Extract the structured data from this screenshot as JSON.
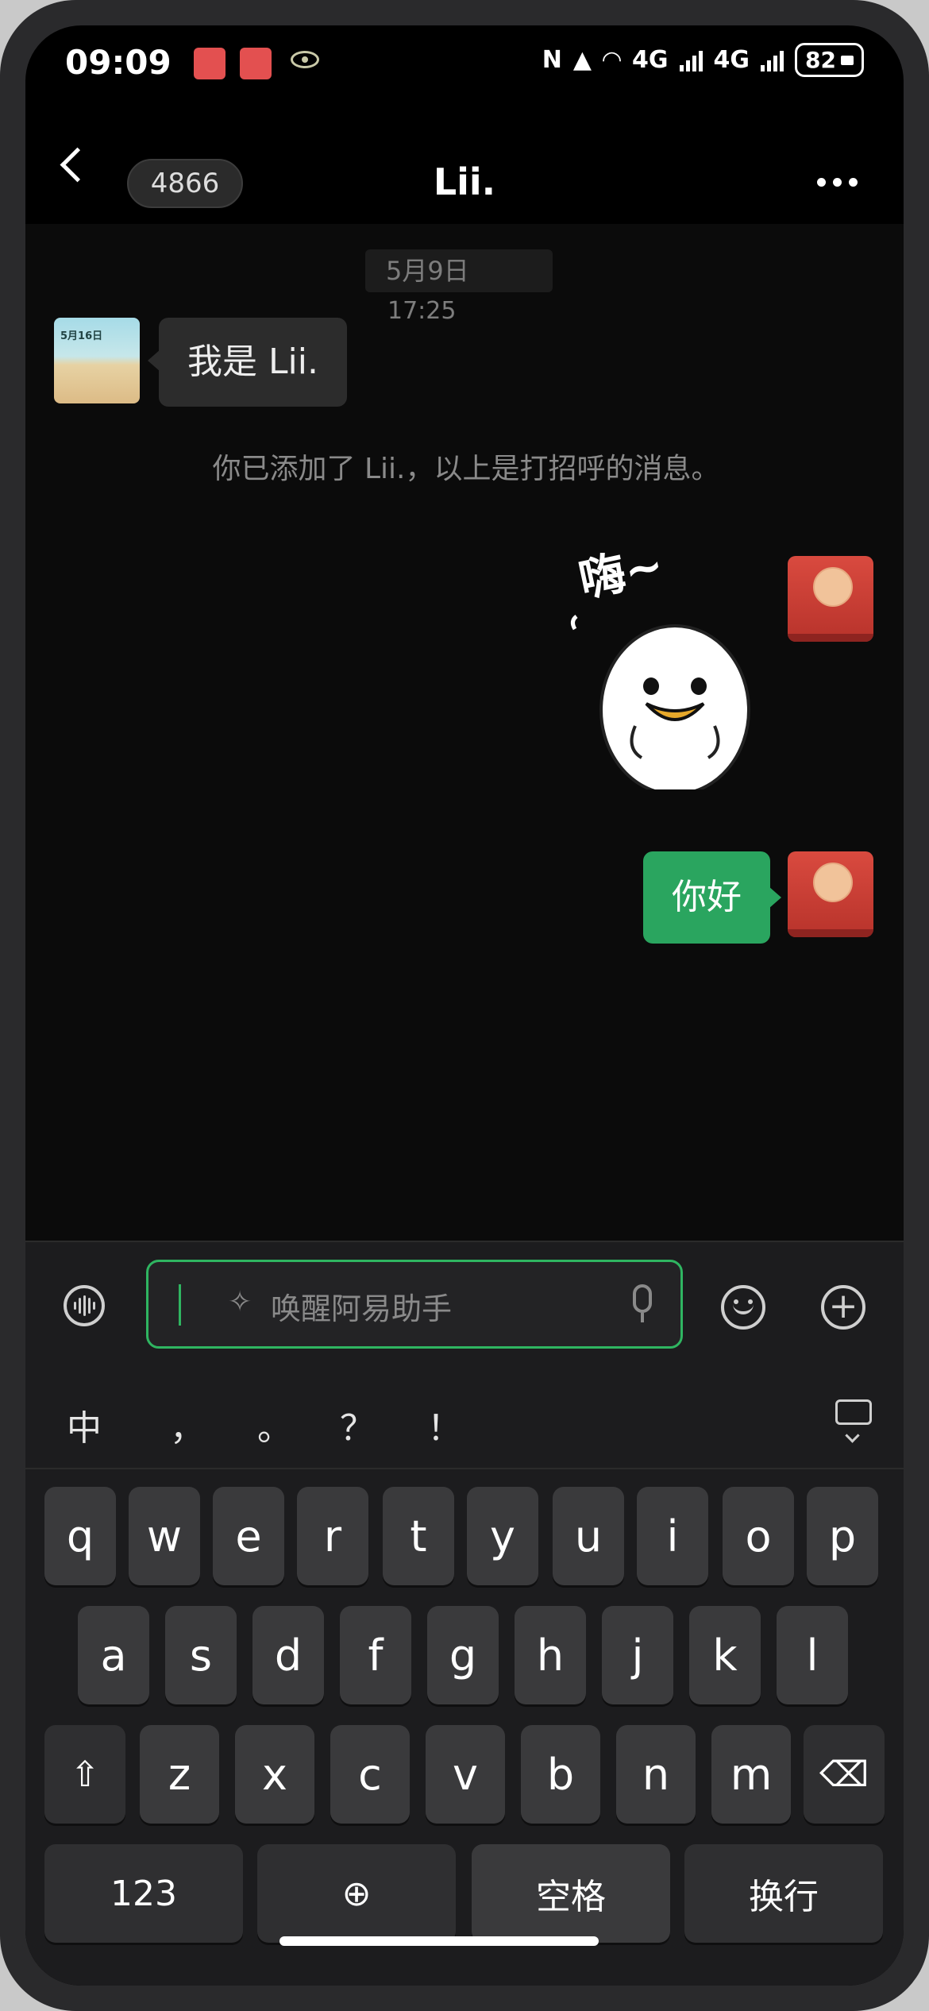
{
  "status_bar": {
    "time": "09:09",
    "nfc": "N",
    "network_1": "4G",
    "network_2": "4G",
    "battery": "82"
  },
  "header": {
    "unread_count": "4866",
    "title": "Lii."
  },
  "chat": {
    "date": "5月9日",
    "time": "17:25",
    "contact_avatar_tag": "5月16日",
    "incoming_message": "我是 Lii.",
    "system_notice": "你已添加了 Lii.，以上是打招呼的消息。",
    "sticker_text": "嗨~",
    "outgoing_message": "你好"
  },
  "input": {
    "placeholder": "唤醒阿易助手"
  },
  "suggestions": [
    "中",
    "，",
    "。",
    "？",
    "！"
  ],
  "keyboard": {
    "row1": [
      "q",
      "w",
      "e",
      "r",
      "t",
      "y",
      "u",
      "i",
      "o",
      "p"
    ],
    "row2": [
      "a",
      "s",
      "d",
      "f",
      "g",
      "h",
      "j",
      "k",
      "l"
    ],
    "row3": [
      "z",
      "x",
      "c",
      "v",
      "b",
      "n",
      "m"
    ],
    "numbers_key": "123",
    "space_key": "空格",
    "enter_key": "换行"
  },
  "colors": {
    "bubble_out": "#2aa55f",
    "bubble_in": "#2c2c2c",
    "accent": "#2fb561"
  }
}
